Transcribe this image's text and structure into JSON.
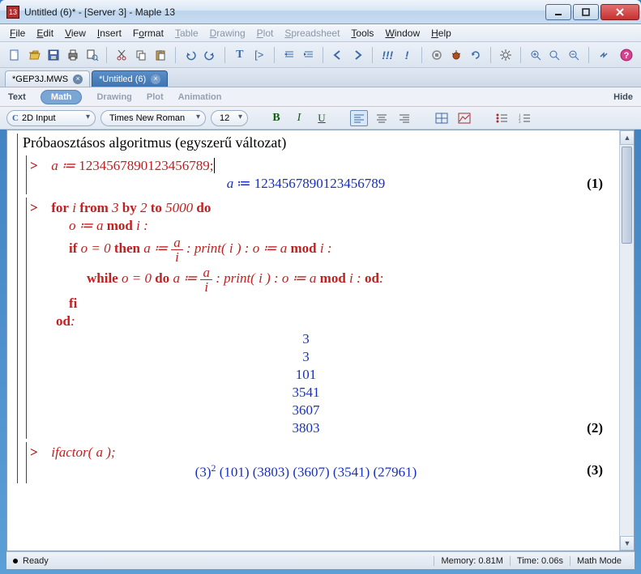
{
  "window": {
    "title": "Untitled (6)* - [Server 3] - Maple 13",
    "app_icon_text": "13"
  },
  "menu": {
    "items": [
      "File",
      "Edit",
      "View",
      "Insert",
      "Format",
      "Table",
      "Drawing",
      "Plot",
      "Spreadsheet",
      "Tools",
      "Window",
      "Help"
    ],
    "disabled": [
      "Table",
      "Drawing",
      "Plot",
      "Spreadsheet"
    ]
  },
  "toolbar_icons": [
    "new",
    "open",
    "save",
    "print",
    "preview",
    "cut",
    "copy",
    "paste",
    "undo",
    "redo",
    "text-mode",
    "math-mode",
    "indent",
    "outdent",
    "back",
    "forward",
    "exec-all",
    "exec-one",
    "stop",
    "debug",
    "restart",
    "settings",
    "zoom-in",
    "zoom-actual",
    "zoom-out",
    "toggle",
    "help"
  ],
  "doctabs": [
    {
      "label": "*GEP3J.MWS",
      "active": false
    },
    {
      "label": "*Untitled (6)",
      "active": true
    }
  ],
  "context_bar": {
    "items": [
      "Text",
      "Math",
      "Drawing",
      "Plot",
      "Animation"
    ],
    "active": "Math",
    "hide": "Hide"
  },
  "format_bar": {
    "style": "2D Input",
    "font": "Times New Roman",
    "size": "12"
  },
  "doc": {
    "title": "Próbaosztásos algoritmus (egyszerű változat)",
    "input1": "a ≔ 1234567890123456789;",
    "output1_lhs": "a ≔ ",
    "output1_val": "1234567890123456789",
    "eq1": "(1)",
    "loop_head": "for i from 3 by 2 to 5000 do",
    "loop_l1": "o ≔ a mod i :",
    "loop_l2_pre": "if o = 0 then a ≔ ",
    "loop_l2_frac_num": "a",
    "loop_l2_frac_den": "i",
    "loop_l2_post": " : print( i ) : o ≔ a mod i :",
    "loop_l3_pre": "while o = 0 do  a ≔ ",
    "loop_l3_post": " : print( i ) : o ≔ a mod i : od:",
    "loop_l4": "fi",
    "loop_l5": "od:",
    "outputs": [
      "3",
      "3",
      "101",
      "3541",
      "3607",
      "3803"
    ],
    "eq2": "(2)",
    "input3": "ifactor( a );",
    "output3": "(3)² (101) (3803) (3607) (3541) (27961)",
    "eq3": "(3)"
  },
  "status": {
    "ready": "Ready",
    "memory": "Memory: 0.81M",
    "time": "Time: 0.06s",
    "mode": "Math Mode"
  }
}
